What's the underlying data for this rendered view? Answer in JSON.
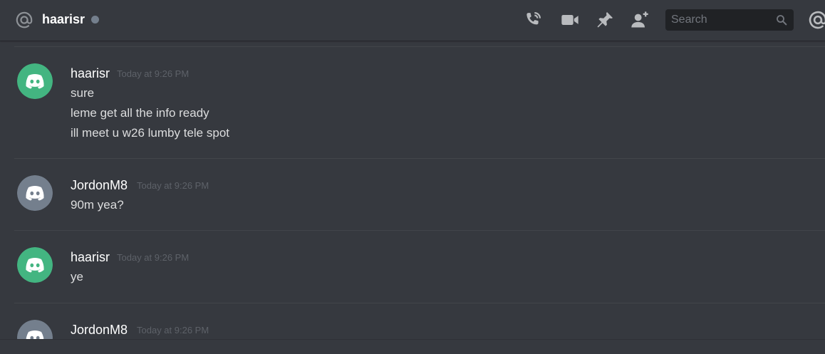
{
  "header": {
    "channel_name": "haarisr",
    "search_placeholder": "Search",
    "icons": [
      "at-icon",
      "start-voice-call-icon",
      "start-video-call-icon",
      "pinned-messages-icon",
      "add-friend-icon",
      "search-icon",
      "mentions-icon"
    ]
  },
  "colors": {
    "background": "#36393f",
    "header_shadow": "#202225",
    "search_bg": "#202225",
    "username": "#ffffff",
    "timestamp": "#5d6168",
    "message_text": "#dcddde",
    "status_offline": "#747f8d",
    "avatar_green": "#43b581",
    "avatar_grey": "#747f8d"
  },
  "messages": [
    {
      "author": "haarisr",
      "timestamp": "Today at 9:26 PM",
      "avatar_color": "green",
      "lines": [
        "sure",
        "leme get all the info ready",
        "ill meet u w26 lumby tele spot"
      ]
    },
    {
      "author": "JordonM8",
      "timestamp": "Today at 9:26 PM",
      "avatar_color": "grey",
      "lines": [
        "90m yea?"
      ]
    },
    {
      "author": "haarisr",
      "timestamp": "Today at 9:26 PM",
      "avatar_color": "green",
      "lines": [
        "ye"
      ]
    },
    {
      "author": "JordonM8",
      "timestamp": "Today at 9:26 PM",
      "avatar_color": "grey",
      "lines": []
    }
  ]
}
